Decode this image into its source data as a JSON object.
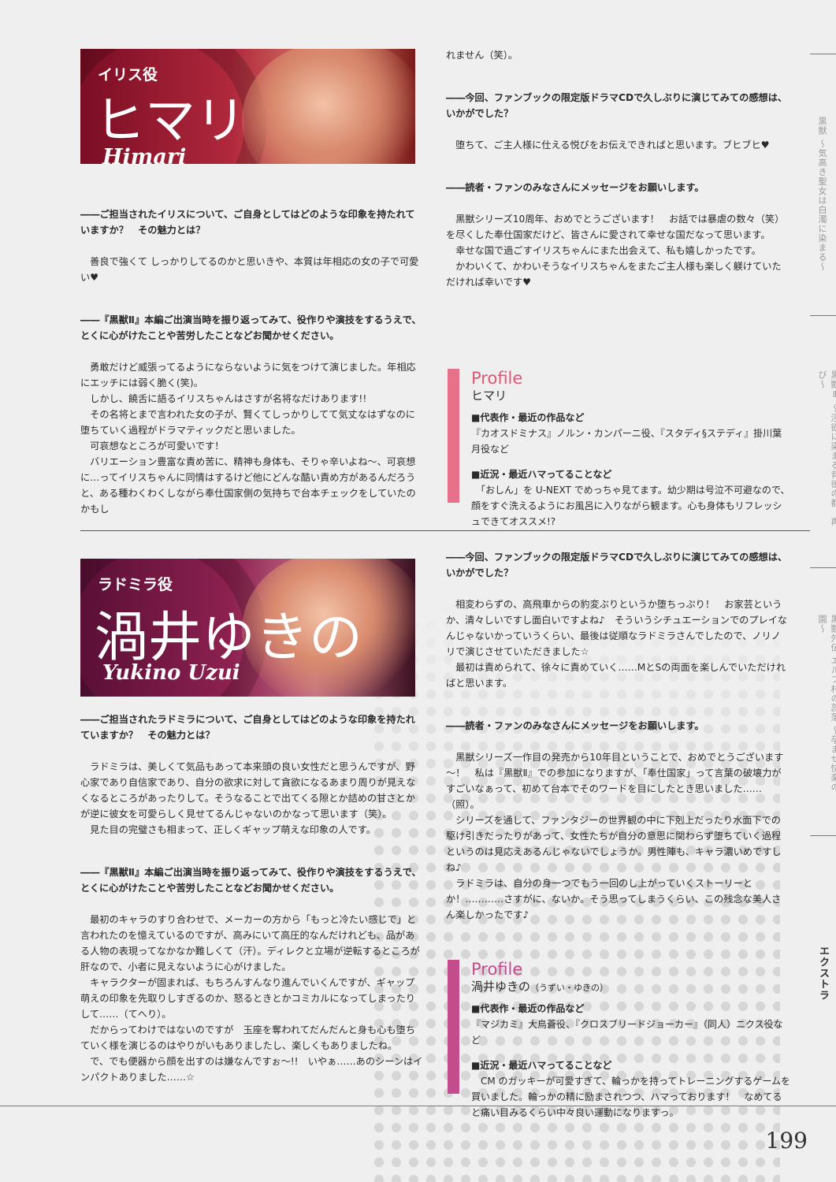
{
  "iris": {
    "role": "イリス役",
    "name": "ヒマリ",
    "roman": "Himari",
    "left": [
      {
        "q": true,
        "t": "――ご担当されたイリスについて、ご自身としてはどのような印象を持たれていますか？　その魅力とは？"
      },
      {
        "t": "　善良で強くて しっかりしてるのかと思いきや、本質は年相応の女の子で可愛い♥"
      },
      {
        "q": true,
        "t": "――『黒獣Ⅱ』本編ご出演当時を振り返ってみて、役作りや演技をするうえで、とくに心がけたことや苦労したことなどお聞かせください。"
      },
      {
        "t": "　勇敢だけど威張ってるようにならないように気をつけて演じました。年相応にエッチには弱く脆く(笑)。"
      },
      {
        "t": "　しかし、饒舌に語るイリスちゃんはさすが名将なだけあります!!"
      },
      {
        "t": "　その名将とまで言われた女の子が、賢くてしっかりしてて気丈なはずなのに堕ちていく過程がドラマティックだと思いました。"
      },
      {
        "t": "　可哀想なところが可愛いです！"
      },
      {
        "t": "　バリエーション豊富な責め苦に、精神も身体も、そりゃ辛いよね～、可哀想に…ってイリスちゃんに同情はするけど他にどんな酷い責め方があるんだろうと、ある種わくわくしながら奉仕国家側の気持ちで台本チェックをしていたのかもし"
      }
    ],
    "right": [
      {
        "t": "れません（笑）。"
      },
      {
        "q": true,
        "t": "――今回、ファンブックの限定版ドラマCDで久しぶりに演じてみての感想は、いかがでした？"
      },
      {
        "t": "　堕ちて、ご主人様に仕える悦びをお伝えできればと思います。ブヒブヒ♥"
      },
      {
        "q": true,
        "t": "――読者・ファンのみなさんにメッセージをお願いします。"
      },
      {
        "t": "　黒獣シリーズ10周年、おめでとうございます！　お話では暴虐の数々（笑）を尽くした奉仕国家だけど、皆さんに愛されて幸せな国だなって思います。"
      },
      {
        "t": "　幸せな国で過ごすイリスちゃんにまた出会えて、私も嬉しかったです。"
      },
      {
        "t": "　かわいくて、かわいそうなイリスちゃんをまたご主人様も楽しく躾けていただければ幸いです♥"
      }
    ],
    "profile": {
      "title": "Profile",
      "name": "ヒマリ",
      "works_h": "■代表作・最近の作品など",
      "works": "『カオスドミナス』ノルン・カンパーニ役、『スタディ§ステディ』掛川葉月役など",
      "recent_h": "■近況・最近ハマってることなど",
      "recent": "　「おしん」を U-NEXT でめっちゃ見てます。幼少期は号泣不可避なので、顔をすぐ洗えるようにお風呂に入りながら観ます。心も身体もリフレッシュできてオススメ!?"
    }
  },
  "ladomira": {
    "role": "ラドミラ役",
    "name": "渦井ゆきの",
    "roman": "Yukino Uzui",
    "left": [
      {
        "q": true,
        "t": "――ご担当されたラドミラについて、ご自身としてはどのような印象を持たれていますか？　その魅力とは？"
      },
      {
        "t": "　ラドミラは、美しくて気品もあって本来頭の良い女性だと思うんですが、野心家であり自信家であり、自分の欲求に対して貪欲になるあまり周りが見えなくなるところがあったりして。そうなることで出てくる隙とか詰めの甘さとかが逆に彼女を可愛らしく見せてるんじゃないのかなって思います（笑）。"
      },
      {
        "t": "　見た目の完璧さも相まって、正しくギャップ萌えな印象の人です。"
      },
      {
        "q": true,
        "t": "――『黒獣Ⅱ』本編ご出演当時を振り返ってみて、役作りや演技をするうえで、とくに心がけたことや苦労したことなどお聞かせください。"
      },
      {
        "t": "　最初のキャラのすり合わせで、メーカーの方から「もっと冷たい感じで」と言われたのを憶えているのですが、高みにいて高圧的なんだけれども、品がある人物の表現ってなかなか難しくて（汗）。ディレクと立場が逆転するところが肝なので、小者に見えないように心がけました。"
      },
      {
        "t": "　キャラクターが固まれば、もちろんすんなり進んでいくんですが、ギャップ萌えの印象を先取りしすぎるのか、怒るときとかコミカルになってしまったりして……（てへり）。"
      },
      {
        "t": "　だからってわけではないのですが　玉座を奪われてだんだんと身も心も堕ちていく様を演じるのはやりがいもありましたし、楽しくもありましたね。"
      },
      {
        "t": "　で、でも便器から顔を出すのは嫌なんですぉ～!!　いやぁ……あのシーンはインパクトありました……☆"
      }
    ],
    "right": [
      {
        "q": true,
        "t": "――今回、ファンブックの限定版ドラマCDで久しぶりに演じてみての感想は、いかがでした？"
      },
      {
        "t": "　相変わらずの、高飛車からの豹変ぶりというか堕ちっぷり！　お家芸というか、清々しいですし面白いですよね♪　そういうシチュエーションでのプレイなんじゃないかっていうくらい、最後は従順なラドミラさんでしたので、ノリノリで演じさせていただきました☆"
      },
      {
        "t": "　最初は責められて、徐々に責めていく……MとSの両面を楽しんでいただければと思います。"
      },
      {
        "q": true,
        "t": "――読者・ファンのみなさんにメッセージをお願いします。"
      },
      {
        "t": "　黒獣シリーズ一作目の発売から10年目ということで、おめでとうございます～！　私は『黒獣Ⅱ』での参加になりますが、「奉仕国家」って言葉の破壊力がすごいなぁって、初めて台本でそのワードを目にしたとき思いました……（照）。"
      },
      {
        "t": "　シリーズを通して、ファンタジーの世界観の中に下剋上だったり水面下での駆け引きだったりがあって、女性たちが自分の意思に関わらず堕ちていく過程というのは見応えあるんじゃないでしょうか。男性陣も、キャラ濃いめですしね♪"
      },
      {
        "t": "　ラドミラは、自分の身一つでもう一回のし上がっていくストーリーとか！…………さすがに、ないか。そう思ってしまうくらい、この残念な美人さん楽しかったです♪"
      }
    ],
    "profile": {
      "title": "Profile",
      "name": "渦井ゆきの",
      "kana": "（うずい・ゆきの）",
      "works_h": "■代表作・最近の作品など",
      "works": "『マジカミ』大鳥蒼役、『クロスブリードジョーカー』（同人）ニクス役など",
      "recent_h": "■近況・最近ハマってることなど",
      "recent": "　CM のガッキーが可愛すぎて、輪っかを持ってトレーニングするゲームを買いました。輪っかの精に励まされつつ、ハマっております！　なめてると痛い目みるくらい中々良い運動になりますっ。"
    }
  },
  "side": {
    "t1": "黒獣 〜気高き聖女は白濁に染まる〜",
    "t2": "黒獣Ⅱ 〜淫欲に染まる背徳の都、再び〜",
    "t3": "黒獣外伝 エルフ村の蕊落 〜孕ませ快楽の園〜",
    "t4": "エクストラ"
  },
  "page_number": "199"
}
